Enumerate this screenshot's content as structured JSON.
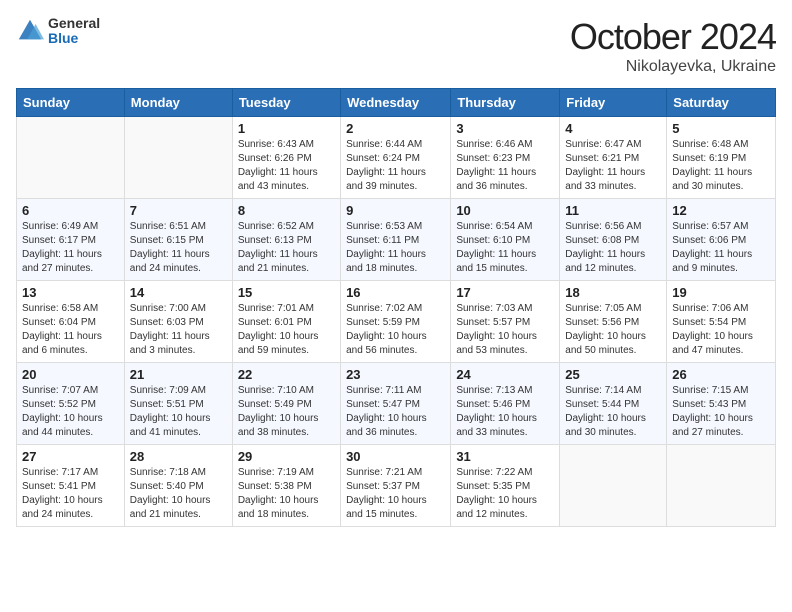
{
  "header": {
    "logo_general": "General",
    "logo_blue": "Blue",
    "month_title": "October 2024",
    "location": "Nikolayevka, Ukraine"
  },
  "days_of_week": [
    "Sunday",
    "Monday",
    "Tuesday",
    "Wednesday",
    "Thursday",
    "Friday",
    "Saturday"
  ],
  "weeks": [
    [
      {
        "day": "",
        "info": ""
      },
      {
        "day": "",
        "info": ""
      },
      {
        "day": "1",
        "info": "Sunrise: 6:43 AM\nSunset: 6:26 PM\nDaylight: 11 hours and 43 minutes."
      },
      {
        "day": "2",
        "info": "Sunrise: 6:44 AM\nSunset: 6:24 PM\nDaylight: 11 hours and 39 minutes."
      },
      {
        "day": "3",
        "info": "Sunrise: 6:46 AM\nSunset: 6:23 PM\nDaylight: 11 hours and 36 minutes."
      },
      {
        "day": "4",
        "info": "Sunrise: 6:47 AM\nSunset: 6:21 PM\nDaylight: 11 hours and 33 minutes."
      },
      {
        "day": "5",
        "info": "Sunrise: 6:48 AM\nSunset: 6:19 PM\nDaylight: 11 hours and 30 minutes."
      }
    ],
    [
      {
        "day": "6",
        "info": "Sunrise: 6:49 AM\nSunset: 6:17 PM\nDaylight: 11 hours and 27 minutes."
      },
      {
        "day": "7",
        "info": "Sunrise: 6:51 AM\nSunset: 6:15 PM\nDaylight: 11 hours and 24 minutes."
      },
      {
        "day": "8",
        "info": "Sunrise: 6:52 AM\nSunset: 6:13 PM\nDaylight: 11 hours and 21 minutes."
      },
      {
        "day": "9",
        "info": "Sunrise: 6:53 AM\nSunset: 6:11 PM\nDaylight: 11 hours and 18 minutes."
      },
      {
        "day": "10",
        "info": "Sunrise: 6:54 AM\nSunset: 6:10 PM\nDaylight: 11 hours and 15 minutes."
      },
      {
        "day": "11",
        "info": "Sunrise: 6:56 AM\nSunset: 6:08 PM\nDaylight: 11 hours and 12 minutes."
      },
      {
        "day": "12",
        "info": "Sunrise: 6:57 AM\nSunset: 6:06 PM\nDaylight: 11 hours and 9 minutes."
      }
    ],
    [
      {
        "day": "13",
        "info": "Sunrise: 6:58 AM\nSunset: 6:04 PM\nDaylight: 11 hours and 6 minutes."
      },
      {
        "day": "14",
        "info": "Sunrise: 7:00 AM\nSunset: 6:03 PM\nDaylight: 11 hours and 3 minutes."
      },
      {
        "day": "15",
        "info": "Sunrise: 7:01 AM\nSunset: 6:01 PM\nDaylight: 10 hours and 59 minutes."
      },
      {
        "day": "16",
        "info": "Sunrise: 7:02 AM\nSunset: 5:59 PM\nDaylight: 10 hours and 56 minutes."
      },
      {
        "day": "17",
        "info": "Sunrise: 7:03 AM\nSunset: 5:57 PM\nDaylight: 10 hours and 53 minutes."
      },
      {
        "day": "18",
        "info": "Sunrise: 7:05 AM\nSunset: 5:56 PM\nDaylight: 10 hours and 50 minutes."
      },
      {
        "day": "19",
        "info": "Sunrise: 7:06 AM\nSunset: 5:54 PM\nDaylight: 10 hours and 47 minutes."
      }
    ],
    [
      {
        "day": "20",
        "info": "Sunrise: 7:07 AM\nSunset: 5:52 PM\nDaylight: 10 hours and 44 minutes."
      },
      {
        "day": "21",
        "info": "Sunrise: 7:09 AM\nSunset: 5:51 PM\nDaylight: 10 hours and 41 minutes."
      },
      {
        "day": "22",
        "info": "Sunrise: 7:10 AM\nSunset: 5:49 PM\nDaylight: 10 hours and 38 minutes."
      },
      {
        "day": "23",
        "info": "Sunrise: 7:11 AM\nSunset: 5:47 PM\nDaylight: 10 hours and 36 minutes."
      },
      {
        "day": "24",
        "info": "Sunrise: 7:13 AM\nSunset: 5:46 PM\nDaylight: 10 hours and 33 minutes."
      },
      {
        "day": "25",
        "info": "Sunrise: 7:14 AM\nSunset: 5:44 PM\nDaylight: 10 hours and 30 minutes."
      },
      {
        "day": "26",
        "info": "Sunrise: 7:15 AM\nSunset: 5:43 PM\nDaylight: 10 hours and 27 minutes."
      }
    ],
    [
      {
        "day": "27",
        "info": "Sunrise: 7:17 AM\nSunset: 5:41 PM\nDaylight: 10 hours and 24 minutes."
      },
      {
        "day": "28",
        "info": "Sunrise: 7:18 AM\nSunset: 5:40 PM\nDaylight: 10 hours and 21 minutes."
      },
      {
        "day": "29",
        "info": "Sunrise: 7:19 AM\nSunset: 5:38 PM\nDaylight: 10 hours and 18 minutes."
      },
      {
        "day": "30",
        "info": "Sunrise: 7:21 AM\nSunset: 5:37 PM\nDaylight: 10 hours and 15 minutes."
      },
      {
        "day": "31",
        "info": "Sunrise: 7:22 AM\nSunset: 5:35 PM\nDaylight: 10 hours and 12 minutes."
      },
      {
        "day": "",
        "info": ""
      },
      {
        "day": "",
        "info": ""
      }
    ]
  ]
}
